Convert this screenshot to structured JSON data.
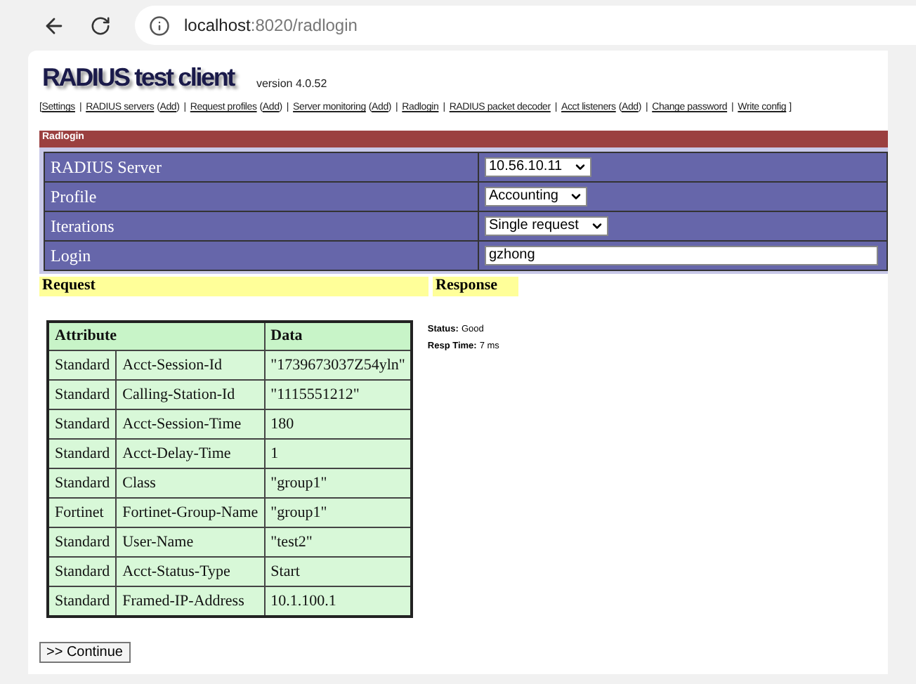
{
  "browser": {
    "url_host": "localhost",
    "url_path": ":8020/radlogin"
  },
  "header": {
    "title": "RADIUS test client",
    "version": "version 4.0.52"
  },
  "nav": [
    {
      "kind": "open",
      "text": "["
    },
    {
      "kind": "link",
      "text": "Settings"
    },
    {
      "kind": "separator",
      "text": "|"
    },
    {
      "kind": "link",
      "text": "RADIUS servers"
    },
    {
      "kind": "open_paren",
      "text": "("
    },
    {
      "kind": "link",
      "text": "Add"
    },
    {
      "kind": "close",
      "text": ")"
    },
    {
      "kind": "separator",
      "text": "|"
    },
    {
      "kind": "link",
      "text": "Request profiles"
    },
    {
      "kind": "open_paren",
      "text": "("
    },
    {
      "kind": "link",
      "text": "Add"
    },
    {
      "kind": "close",
      "text": ")"
    },
    {
      "kind": "separator",
      "text": "|"
    },
    {
      "kind": "link",
      "text": "Server monitoring"
    },
    {
      "kind": "open_paren",
      "text": "("
    },
    {
      "kind": "link",
      "text": "Add"
    },
    {
      "kind": "close",
      "text": ")"
    },
    {
      "kind": "separator",
      "text": "|"
    },
    {
      "kind": "link",
      "text": "Radlogin"
    },
    {
      "kind": "separator",
      "text": "|"
    },
    {
      "kind": "link",
      "text": "RADIUS packet decoder"
    },
    {
      "kind": "separator",
      "text": "|"
    },
    {
      "kind": "link",
      "text": "Acct listeners"
    },
    {
      "kind": "open_paren",
      "text": "("
    },
    {
      "kind": "link",
      "text": "Add"
    },
    {
      "kind": "close",
      "text": ")"
    },
    {
      "kind": "separator",
      "text": "|"
    },
    {
      "kind": "link",
      "text": "Change password"
    },
    {
      "kind": "separator",
      "text": "|"
    },
    {
      "kind": "link",
      "text": "Write config"
    },
    {
      "kind": "close_bracket",
      "text": "]"
    }
  ],
  "panel": {
    "title": "Radlogin"
  },
  "form": [
    {
      "label": "RADIUS Server",
      "kind": "select",
      "value": "10.56.10.11"
    },
    {
      "label": "Profile",
      "kind": "select",
      "value": "Accounting"
    },
    {
      "label": "Iterations",
      "kind": "select",
      "value": "Single request"
    },
    {
      "label": "Login",
      "kind": "text",
      "value": "gzhong"
    }
  ],
  "request_heading": "Request",
  "response_heading": "Response",
  "table": {
    "columns": [
      {
        "label": "Attribute",
        "colspan": 2
      },
      {
        "label": "Data"
      }
    ],
    "rows": [
      [
        "Standard",
        "Acct-Session-Id",
        "\"1739673037Z54yln\""
      ],
      [
        "Standard",
        "Calling-Station-Id",
        "\"1115551212\""
      ],
      [
        "Standard",
        "Acct-Session-Time",
        "180"
      ],
      [
        "Standard",
        "Acct-Delay-Time",
        "1"
      ],
      [
        "Standard",
        "Class",
        "\"group1\""
      ],
      [
        "Fortinet",
        "Fortinet-Group-Name",
        "\"group1\""
      ],
      [
        "Standard",
        "User-Name",
        "\"test2\""
      ],
      [
        "Standard",
        "Acct-Status-Type",
        "Start"
      ],
      [
        "Standard",
        "Framed-IP-Address",
        "10.1.100.1"
      ]
    ]
  },
  "response": [
    {
      "label": "Status:",
      "value": "Good"
    },
    {
      "label": "Resp Time:",
      "value": "7 ms"
    }
  ],
  "continue_button": ">> Continue"
}
